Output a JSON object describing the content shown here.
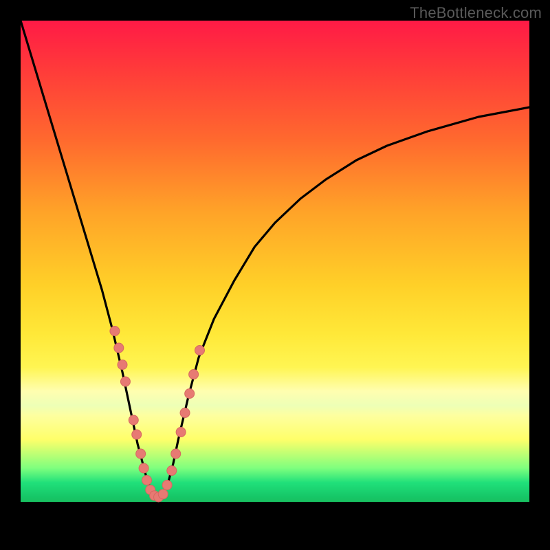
{
  "watermark": "TheBottleneck.com",
  "colors": {
    "frame": "#000000",
    "curve": "#000000",
    "marker_fill": "#e77a73",
    "marker_stroke": "#d66860"
  },
  "chart_data": {
    "type": "line",
    "title": "",
    "xlabel": "",
    "ylabel": "",
    "xlim": [
      0,
      100
    ],
    "ylim": [
      0,
      100
    ],
    "grid": false,
    "series": [
      {
        "name": "bottleneck-curve",
        "x": [
          0,
          2,
          4,
          6,
          8,
          10,
          12,
          14,
          16,
          18,
          20,
          21,
          22,
          23,
          24,
          25,
          26,
          27,
          28,
          29,
          30,
          31,
          33,
          35,
          38,
          42,
          46,
          50,
          55,
          60,
          66,
          72,
          80,
          90,
          100
        ],
        "y": [
          100,
          93,
          86,
          79,
          72,
          65,
          58,
          51,
          44,
          36,
          27,
          22,
          17,
          12,
          8,
          4,
          2,
          1,
          2,
          4,
          8,
          13,
          22,
          30,
          38,
          46,
          53,
          58,
          63,
          67,
          71,
          74,
          77,
          80,
          82
        ]
      }
    ],
    "markers": [
      {
        "name": "pt-left-upper-1",
        "x": 18.5,
        "y": 35.5
      },
      {
        "name": "pt-left-upper-2",
        "x": 19.3,
        "y": 32.0
      },
      {
        "name": "pt-left-upper-3",
        "x": 20.0,
        "y": 28.5
      },
      {
        "name": "pt-left-upper-4",
        "x": 20.6,
        "y": 25.0
      },
      {
        "name": "pt-left-mid-1",
        "x": 22.2,
        "y": 17.0
      },
      {
        "name": "pt-left-mid-2",
        "x": 22.8,
        "y": 14.0
      },
      {
        "name": "pt-left-low-1",
        "x": 23.6,
        "y": 10.0
      },
      {
        "name": "pt-left-low-2",
        "x": 24.2,
        "y": 7.0
      },
      {
        "name": "pt-bottom-1",
        "x": 24.8,
        "y": 4.5
      },
      {
        "name": "pt-bottom-2",
        "x": 25.5,
        "y": 2.5
      },
      {
        "name": "pt-bottom-3",
        "x": 26.3,
        "y": 1.3
      },
      {
        "name": "pt-bottom-4",
        "x": 27.1,
        "y": 1.0
      },
      {
        "name": "pt-bottom-5",
        "x": 28.0,
        "y": 1.6
      },
      {
        "name": "pt-bottom-6",
        "x": 28.8,
        "y": 3.5
      },
      {
        "name": "pt-right-low-1",
        "x": 29.7,
        "y": 6.5
      },
      {
        "name": "pt-right-low-2",
        "x": 30.5,
        "y": 10.0
      },
      {
        "name": "pt-right-mid-1",
        "x": 31.5,
        "y": 14.5
      },
      {
        "name": "pt-right-mid-2",
        "x": 32.3,
        "y": 18.5
      },
      {
        "name": "pt-right-upper-1",
        "x": 33.2,
        "y": 22.5
      },
      {
        "name": "pt-right-upper-2",
        "x": 34.0,
        "y": 26.5
      },
      {
        "name": "pt-right-top",
        "x": 35.2,
        "y": 31.5
      }
    ]
  }
}
